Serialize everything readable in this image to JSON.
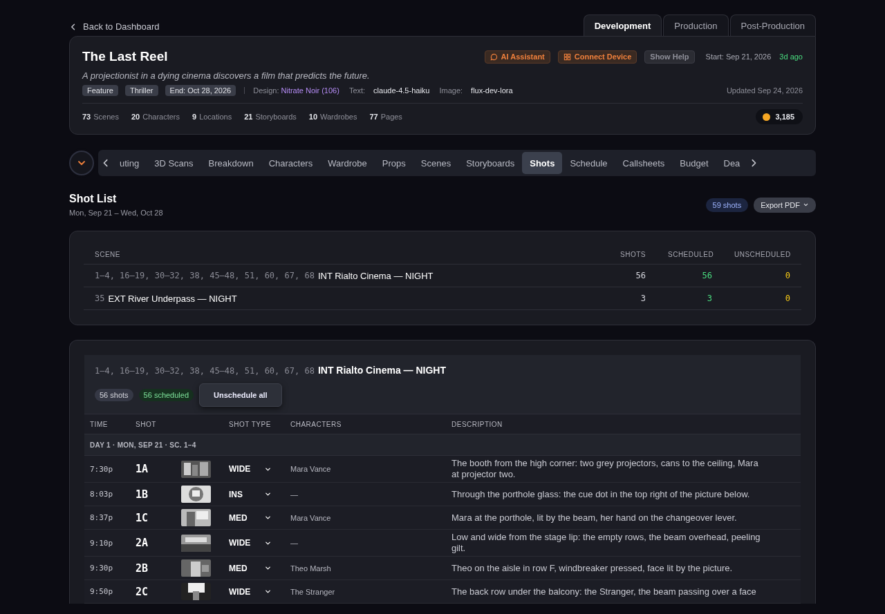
{
  "back_link": {
    "label": "Back to Dashboard"
  },
  "phase_tabs": [
    {
      "label": "Development",
      "selected": true
    },
    {
      "label": "Production",
      "selected": false
    },
    {
      "label": "Post-Production",
      "selected": false
    }
  ],
  "project": {
    "title": "The Last Reel",
    "logline": "A projectionist in a dying cinema discovers a film that predicts the future.",
    "actions": [
      {
        "label": "AI Assistant",
        "kind": "assistant"
      },
      {
        "label": "Connect Device",
        "kind": "device"
      },
      {
        "label": "Show Help",
        "kind": "help"
      }
    ],
    "start": "Start: Sep 21, 2026",
    "start_ago": "3d ago",
    "tags": [
      "Feature",
      "Thriller",
      "End: Oct 28, 2026"
    ],
    "meta": [
      {
        "label": "Design:",
        "value": "Nitrate Noir (106)",
        "kind": "accent"
      },
      {
        "label": "Text:",
        "value": "claude-4.5-haiku",
        "kind": "plain"
      },
      {
        "label": "Image:",
        "value": "flux-dev-lora",
        "kind": "plain"
      }
    ],
    "updated": "Updated Sep 24, 2026",
    "stats": [
      {
        "count": "73",
        "label": "Scenes"
      },
      {
        "count": "20",
        "label": "Characters"
      },
      {
        "count": "9",
        "label": "Locations"
      },
      {
        "count": "21",
        "label": "Storyboards"
      },
      {
        "count": "10",
        "label": "Wardrobes"
      },
      {
        "count": "77",
        "label": "Pages"
      }
    ],
    "credits": "3,185"
  },
  "section_tabs": [
    {
      "label": "uting",
      "selected": false
    },
    {
      "label": "3D Scans",
      "selected": false
    },
    {
      "label": "Breakdown",
      "selected": false
    },
    {
      "label": "Characters",
      "selected": false
    },
    {
      "label": "Wardrobe",
      "selected": false
    },
    {
      "label": "Props",
      "selected": false
    },
    {
      "label": "Scenes",
      "selected": false
    },
    {
      "label": "Storyboards",
      "selected": false
    },
    {
      "label": "Shots",
      "selected": true
    },
    {
      "label": "Schedule",
      "selected": false
    },
    {
      "label": "Callsheets",
      "selected": false
    },
    {
      "label": "Budget",
      "selected": false
    },
    {
      "label": "Dea",
      "selected": false
    }
  ],
  "shot_list": {
    "title": "Shot List",
    "dates": "Mon, Sep 21 – Wed, Oct 28",
    "count_badge": "59 shots",
    "export": "Export PDF"
  },
  "summary": {
    "columns": [
      "SCENE",
      "SHOTS",
      "SCHEDULED",
      "UNSCHEDULED"
    ],
    "rows": [
      {
        "numbers": "1–4, 16–19, 30–32, 38, 45–48, 51, 60, 67, 68",
        "heading": "INT Rialto Cinema — NIGHT",
        "shots": "56",
        "scheduled": "56",
        "unscheduled": "0"
      },
      {
        "numbers": "35",
        "heading": "EXT River Underpass — NIGHT",
        "shots": "3",
        "scheduled": "3",
        "unscheduled": "0"
      }
    ]
  },
  "scene_group": {
    "numbers": "1–4, 16–19, 30–32, 38, 45–48, 51, 60, 67, 68",
    "heading": "INT Rialto Cinema — NIGHT",
    "shots_badge": "56 shots",
    "scheduled_badge": "56 scheduled",
    "action": "Unschedule all",
    "columns": [
      "TIME",
      "SHOT",
      "SHOT TYPE",
      "CHARACTERS",
      "DESCRIPTION"
    ],
    "day_header": "DAY 1 · MON, SEP 21 · SC. 1–4",
    "shots": [
      {
        "time": "7:30p",
        "shot": "1A",
        "type": "WIDE",
        "characters": "Mara Vance",
        "description": "The booth from the high corner: two grey projectors, cans to the ceiling, Mara at projector two."
      },
      {
        "time": "8:03p",
        "shot": "1B",
        "type": "INS",
        "characters": "—",
        "description": "Through the porthole glass: the cue dot in the top right of the picture below."
      },
      {
        "time": "8:37p",
        "shot": "1C",
        "type": "MED",
        "characters": "Mara Vance",
        "description": "Mara at the porthole, lit by the beam, her hand on the changeover lever."
      },
      {
        "time": "9:10p",
        "shot": "2A",
        "type": "WIDE",
        "characters": "—",
        "description": "Low and wide from the stage lip: the empty rows, the beam overhead, peeling gilt."
      },
      {
        "time": "9:30p",
        "shot": "2B",
        "type": "MED",
        "characters": "Theo Marsh",
        "description": "Theo on the aisle in row F, windbreaker pressed, face lit by the picture."
      },
      {
        "time": "9:50p",
        "shot": "2C",
        "type": "WIDE",
        "characters": "The Stranger",
        "description": "The back row under the balcony: the Stranger, the beam passing over a face"
      }
    ]
  }
}
